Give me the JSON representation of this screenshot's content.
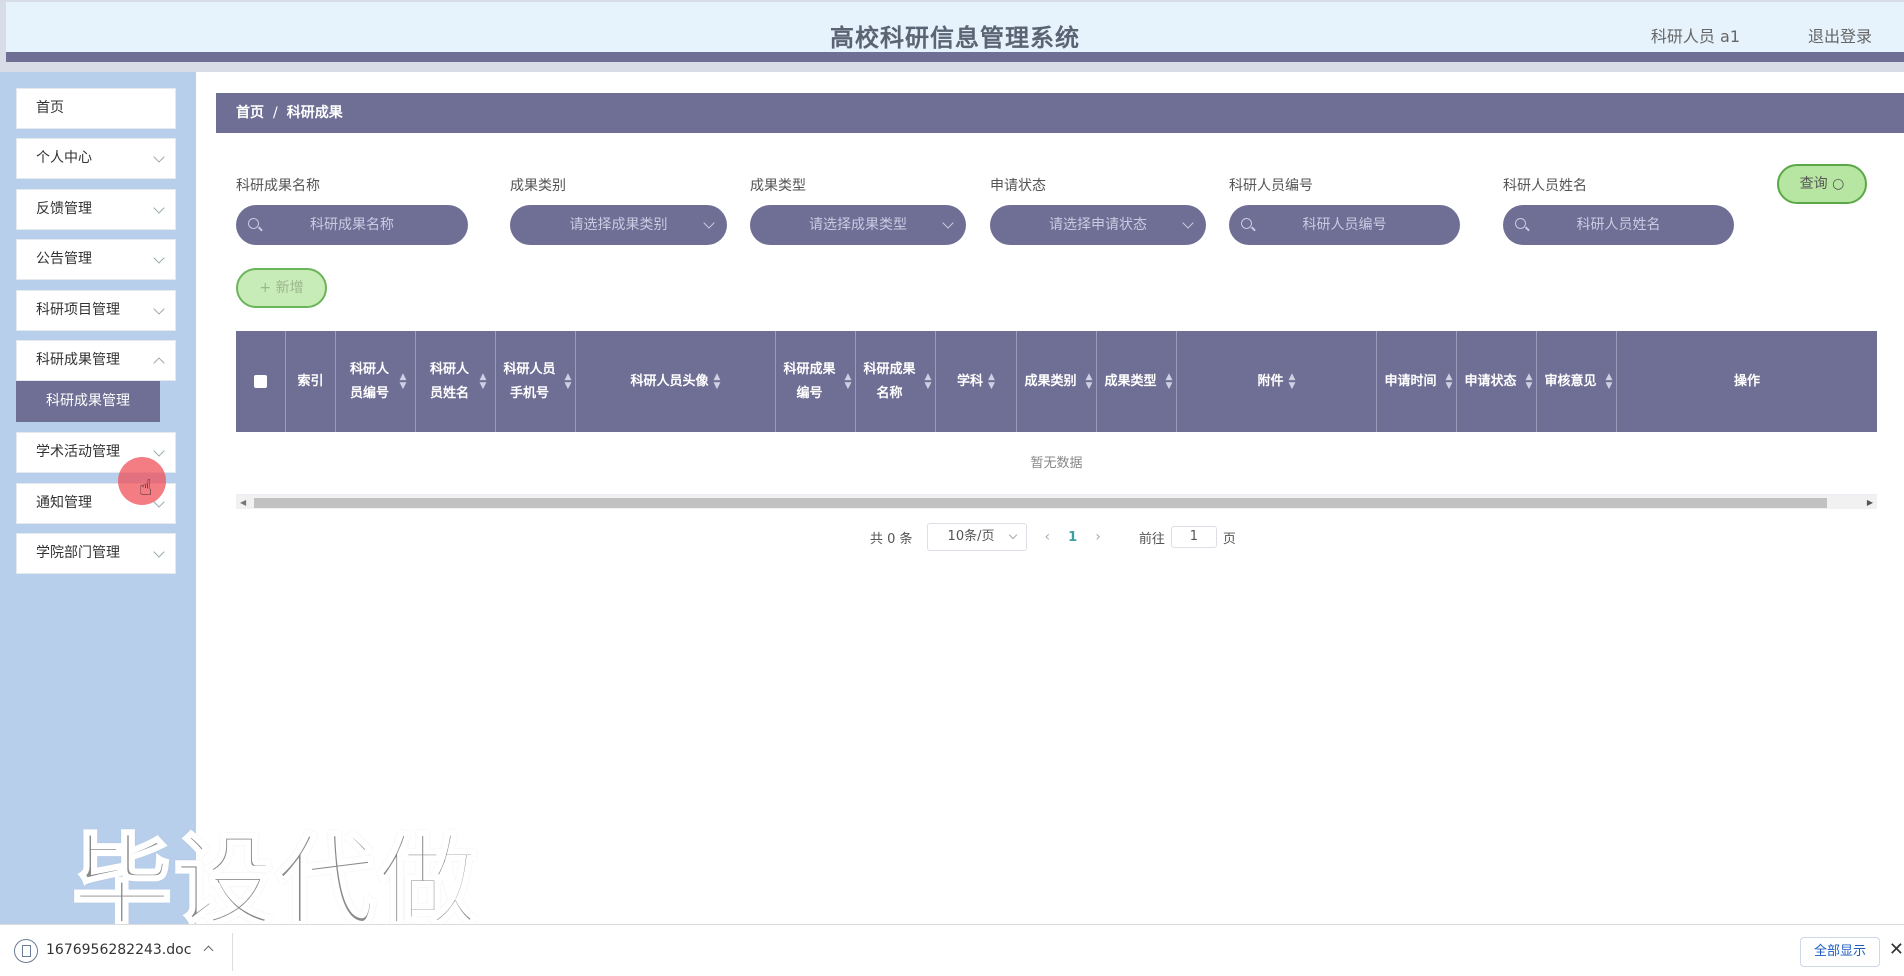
{
  "header": {
    "title": "高校科研信息管理系统",
    "user": "科研人员 a1",
    "logout": "退出登录"
  },
  "sidebar": {
    "items": [
      {
        "label": "首页",
        "expandable": false
      },
      {
        "label": "个人中心",
        "expandable": true
      },
      {
        "label": "反馈管理",
        "expandable": true
      },
      {
        "label": "公告管理",
        "expandable": true
      },
      {
        "label": "科研项目管理",
        "expandable": true
      },
      {
        "label": "科研成果管理",
        "expandable": true
      },
      {
        "label": "学术活动管理",
        "expandable": true
      },
      {
        "label": "通知管理",
        "expandable": true
      },
      {
        "label": "学院部门管理",
        "expandable": true
      }
    ],
    "active_submenu": "科研成果管理"
  },
  "breadcrumb": {
    "home": "首页",
    "separator": "/",
    "current": "科研成果"
  },
  "search": {
    "fields": [
      {
        "label": "科研成果名称",
        "placeholder": "科研成果名称",
        "type": "input"
      },
      {
        "label": "成果类别",
        "placeholder": "请选择成果类别",
        "type": "select"
      },
      {
        "label": "成果类型",
        "placeholder": "请选择成果类型",
        "type": "select"
      },
      {
        "label": "申请状态",
        "placeholder": "请选择申请状态",
        "type": "select"
      },
      {
        "label": "科研人员编号",
        "placeholder": "科研人员编号",
        "type": "input"
      },
      {
        "label": "科研人员姓名",
        "placeholder": "科研人员姓名",
        "type": "input"
      }
    ],
    "query_label": "查询"
  },
  "actions": {
    "add_label": "+ 新增"
  },
  "table": {
    "columns": [
      {
        "label": "索引",
        "sortable": false
      },
      {
        "label": "科研人员编号",
        "sortable": true
      },
      {
        "label": "科研人员姓名",
        "sortable": true
      },
      {
        "label": "科研人员手机号",
        "sortable": true
      },
      {
        "label": "科研人员头像",
        "sortable": true
      },
      {
        "label": "科研成果编号",
        "sortable": true
      },
      {
        "label": "科研成果名称",
        "sortable": true
      },
      {
        "label": "学科",
        "sortable": true
      },
      {
        "label": "成果类别",
        "sortable": true
      },
      {
        "label": "成果类型",
        "sortable": true
      },
      {
        "label": "附件",
        "sortable": true
      },
      {
        "label": "申请时间",
        "sortable": true
      },
      {
        "label": "申请状态",
        "sortable": true
      },
      {
        "label": "审核意见",
        "sortable": true
      },
      {
        "label": "操作",
        "sortable": false
      }
    ],
    "empty_text": "暂无数据"
  },
  "pagination": {
    "total": "共 0 条",
    "page_size": "10条/页",
    "current_page": "1",
    "goto_label": "前往",
    "goto_value": "1",
    "page_suffix": "页"
  },
  "watermark": "毕设代做",
  "download_bar": {
    "file_name": "1676956282243.doc",
    "show_all": "全部显示",
    "close": "✕"
  }
}
